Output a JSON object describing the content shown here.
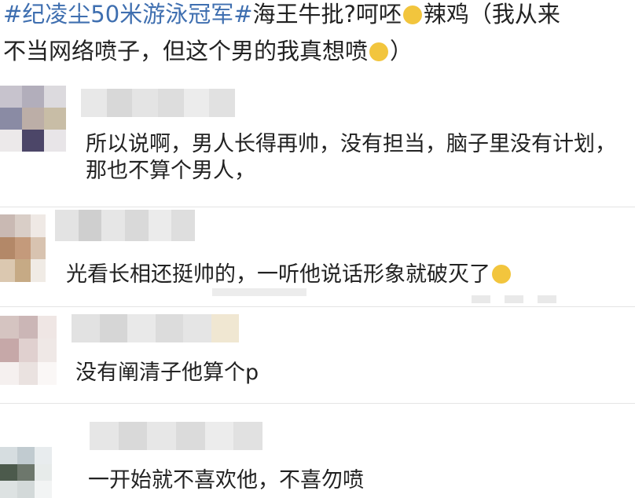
{
  "post": {
    "line1": {
      "topic1": "#纪凌尘50米游泳冠军#",
      "topic2": "海王牛批?",
      "text1": "呵呸",
      "text2": "辣鸡（我从来"
    },
    "line2": {
      "text1": "不当网络喷子，但这个男的我真想喷",
      "text2": "）"
    },
    "emoji_name": "smile-emoji"
  },
  "comments": [
    {
      "text": "所以说啊，男人长得再帅，没有担当，脑子里没有计划，那也不算个男人，",
      "avatar": [
        "#c7c3cd",
        "#b2aebb",
        "#dcdade",
        "#8a8ba4",
        "#bcaea7",
        "#c8bda6",
        "#ece9ea",
        "#4c4668",
        "#e8e5e8"
      ],
      "name_blocks": [
        "#e8e8e8",
        "#d8d8d8",
        "#e4e4e4",
        "#dddddd",
        "#ececec",
        "#e1e1e1"
      ]
    },
    {
      "text": "光看长相还挺帅的，一听他说话形象就破灭了",
      "avatar": [
        "#c9b9b3",
        "#d9cec7",
        "#efe9e5",
        "#b38868",
        "#c49a7b",
        "#d8c3b0",
        "#dbc8b0",
        "#c6aa85",
        "#f0ebe5"
      ],
      "name_blocks": [
        "#e3e3e3",
        "#cfcfcf",
        "#e6e6e6",
        "#d9d9d9",
        "#ebebeb",
        "#dedede"
      ]
    },
    {
      "text": "没有阐清子他算个p",
      "avatar": [
        "#d5c4c1",
        "#cbb6b6",
        "#efe6e4",
        "#c6a8a8",
        "#e0d0cf",
        "#efe8e6",
        "#f5f0ef",
        "#eae2e0",
        "#faf7f6"
      ],
      "name_blocks": [
        "#e2e2e2",
        "#d6d6d6",
        "#e9e9e9",
        "#dcdcdc",
        "#e5e5e5",
        "#f0e7d2"
      ]
    },
    {
      "text": "一开始就不喜欢他，不喜勿喷",
      "avatar": [
        "#d6dde0",
        "#c1cbd0",
        "#e8ecee",
        "#4c5a4c",
        "#6d776c",
        "#e7ebea",
        "#dde2e2",
        "#d3d9d9",
        "#f2f4f4"
      ],
      "name_blocks": [
        "#e6e6e6",
        "#d9d9d9",
        "#e7e7e7",
        "#dbdbdb",
        "#ececec",
        "#e1e1e1"
      ]
    }
  ]
}
